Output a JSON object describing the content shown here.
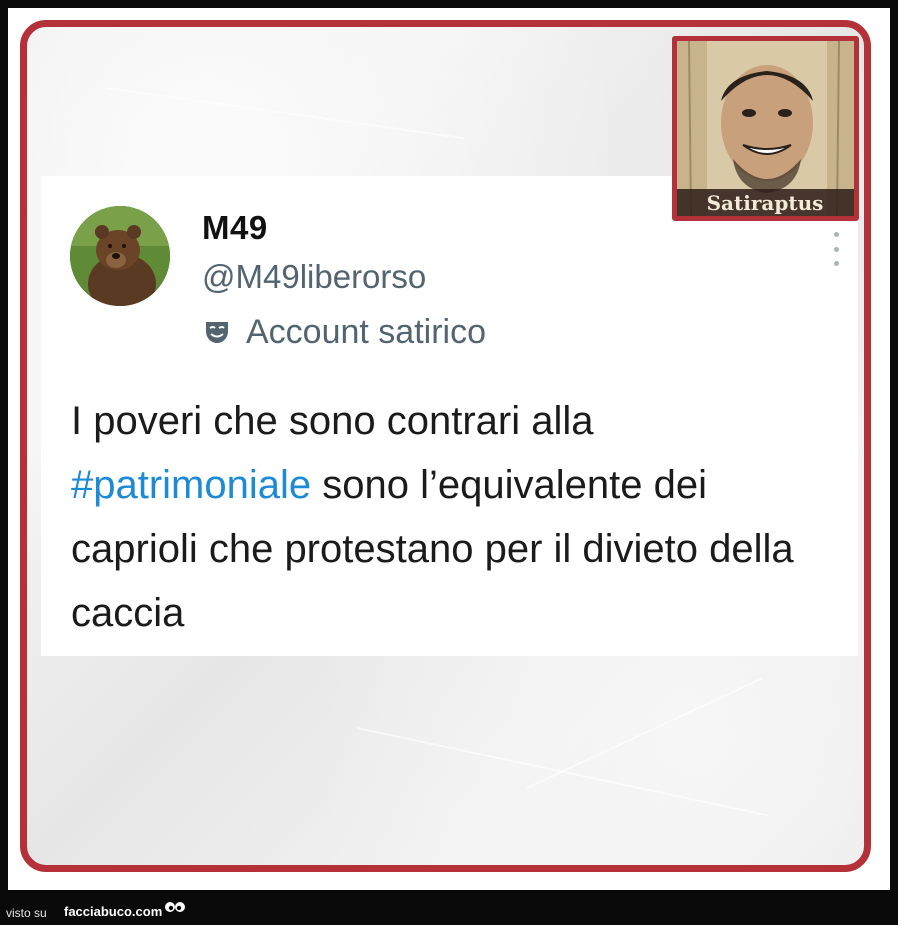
{
  "tweet": {
    "display_name": "M49",
    "handle": "@M49liberorso",
    "label": "Account satirico",
    "label_icon": "theater-mask-icon",
    "text_before": "I poveri che sono contrari alla ",
    "hashtag": "#patrimoniale",
    "text_after": " sono l’equivalente dei caprioli che protestano per il divieto della caccia",
    "hashtag_color": "#1d8ad6",
    "more_icon": "more-options-icon"
  },
  "watermark": {
    "signature_text": "Satiraptus"
  },
  "footer": {
    "visto_label": "visto su",
    "site_name": "facciabuco.com"
  },
  "colors": {
    "frame_red": "#b5313a",
    "secondary_text": "#536471",
    "background": "#0a0a0a"
  }
}
